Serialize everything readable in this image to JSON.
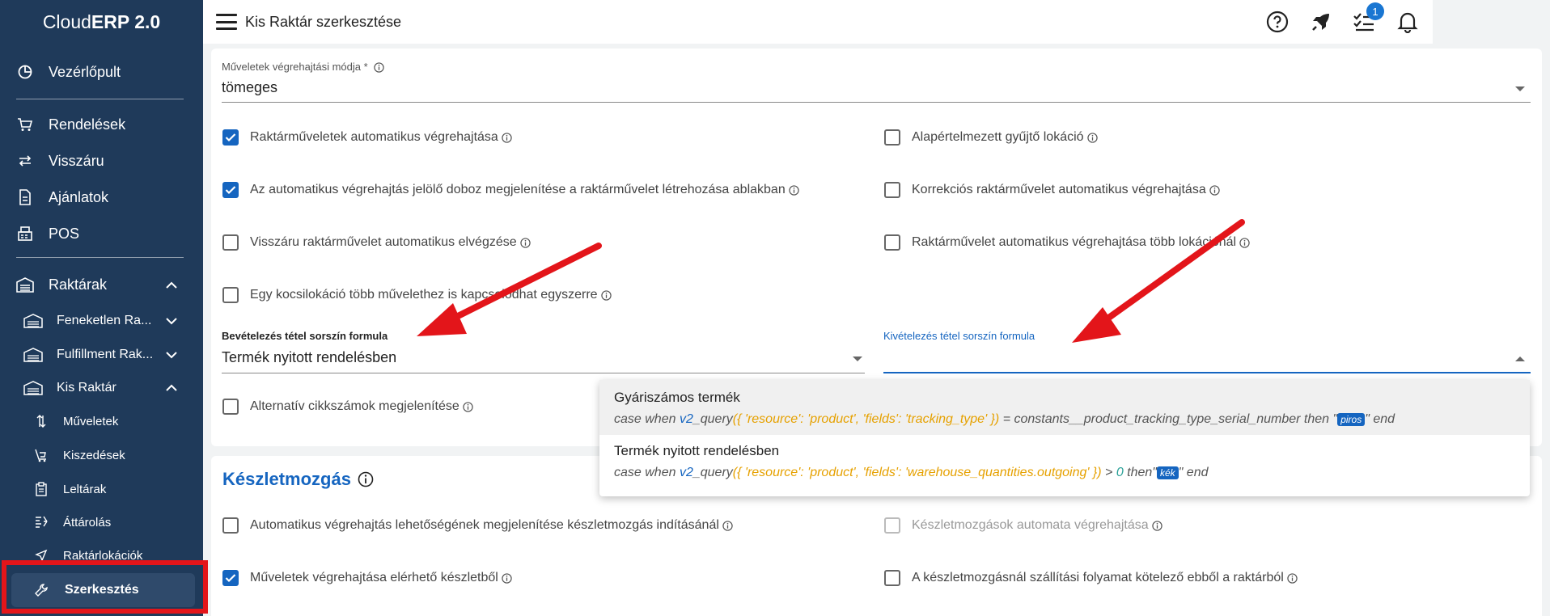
{
  "sidebar": {
    "brand_light": "Cloud",
    "brand_bold": "ERP 2.0",
    "items": [
      {
        "label": "Vezérlőpult",
        "icon": "dashboard-icon"
      },
      {
        "label": "Rendelések",
        "icon": "cart-icon"
      },
      {
        "label": "Visszáru",
        "icon": "swap-icon"
      },
      {
        "label": "Ajánlatok",
        "icon": "document-icon"
      },
      {
        "label": "POS",
        "icon": "pos-icon"
      },
      {
        "label": "Raktárak",
        "icon": "warehouse-icon"
      }
    ],
    "warehouses": [
      {
        "label": "Feneketlen Ra...",
        "icon": "warehouse-icon"
      },
      {
        "label": "Fulfillment Rak...",
        "icon": "warehouse-icon"
      },
      {
        "label": "Kis Raktár",
        "icon": "warehouse-icon"
      }
    ],
    "sub": [
      {
        "label": "Műveletek",
        "icon": "arrows-vertical-icon"
      },
      {
        "label": "Kiszedések",
        "icon": "trolley-icon"
      },
      {
        "label": "Leltárak",
        "icon": "clipboard-icon"
      },
      {
        "label": "Áttárolás",
        "icon": "transfer-icon"
      },
      {
        "label": "Raktárlokációk",
        "icon": "location-arrow-icon"
      }
    ],
    "active": {
      "label": "Szerkesztés",
      "icon": "wrench-icon"
    }
  },
  "topbar": {
    "title": "Kis Raktár szerkesztése",
    "notification_badge": "1"
  },
  "form": {
    "exec_mode_label": "Műveletek végrehajtási módja *",
    "exec_mode_value": "tömeges",
    "checkboxes_left": [
      {
        "label": "Raktárműveletek automatikus végrehajtása",
        "checked": true
      },
      {
        "label": "Az automatikus végrehajtás jelölő doboz megjelenítése a raktárművelet létrehozása ablakban",
        "checked": true
      },
      {
        "label": "Visszáru raktárművelet automatikus elvégzése",
        "checked": false
      },
      {
        "label": "Egy kocsilokáció több művelethez is kapcsolódhat egyszerre",
        "checked": false
      }
    ],
    "checkboxes_right": [
      {
        "label": "Alapértelmezett gyűjtő lokáció",
        "checked": false
      },
      {
        "label": "Korrekciós raktárművelet automatikus végrehajtása",
        "checked": false
      },
      {
        "label": "Raktárművelet automatikus végrehajtása több lokációnál",
        "checked": false
      }
    ],
    "inbound_label": "Bevételezés tétel sorszín formula",
    "inbound_value": "Termék nyitott rendelésben",
    "outbound_label": "Kivételezés tétel sorszín formula",
    "outbound_value": "",
    "alt_sku_label": "Alternatív cikkszámok megjelenítése",
    "alt_sku_checked": false
  },
  "dropdown": {
    "options": [
      {
        "title": "Gyáriszámos termék",
        "code_pre": "case when ",
        "code_fn": "v2",
        "code_mid": "_query",
        "code_args": "({ 'resource': 'product', 'fields': 'tracking_type' })",
        "code_post": " = constants__product_tracking_type_serial_number then \"",
        "tag": "piros",
        "code_end": "\" end"
      },
      {
        "title": "Termék nyitott rendelésben",
        "code_pre": "case when ",
        "code_fn": "v2",
        "code_mid": "_query",
        "code_args": "({ 'resource': 'product', 'fields': 'warehouse_quantities.outgoing' })",
        "code_gt": " > ",
        "code_num": "0",
        "code_post": " then\"",
        "tag": "kék",
        "code_end": "\" end"
      }
    ]
  },
  "stock": {
    "title": "Készletmozgás",
    "checkboxes_left": [
      {
        "label": "Automatikus végrehajtás lehetőségének megjelenítése készletmozgás indításánál",
        "checked": false
      },
      {
        "label": "Műveletek végrehajtása elérhető készletből",
        "checked": true
      }
    ],
    "checkboxes_right": [
      {
        "label": "Készletmozgások automata végrehajtása",
        "checked": false,
        "disabled": true
      },
      {
        "label": "A készletmozgásnál szállítási folyamat kötelező ebből a raktárból",
        "checked": false
      }
    ]
  },
  "colors": {
    "sidebar_bg": "#1f3a5a",
    "accent": "#1565c0",
    "highlight_red": "#e3151a"
  }
}
